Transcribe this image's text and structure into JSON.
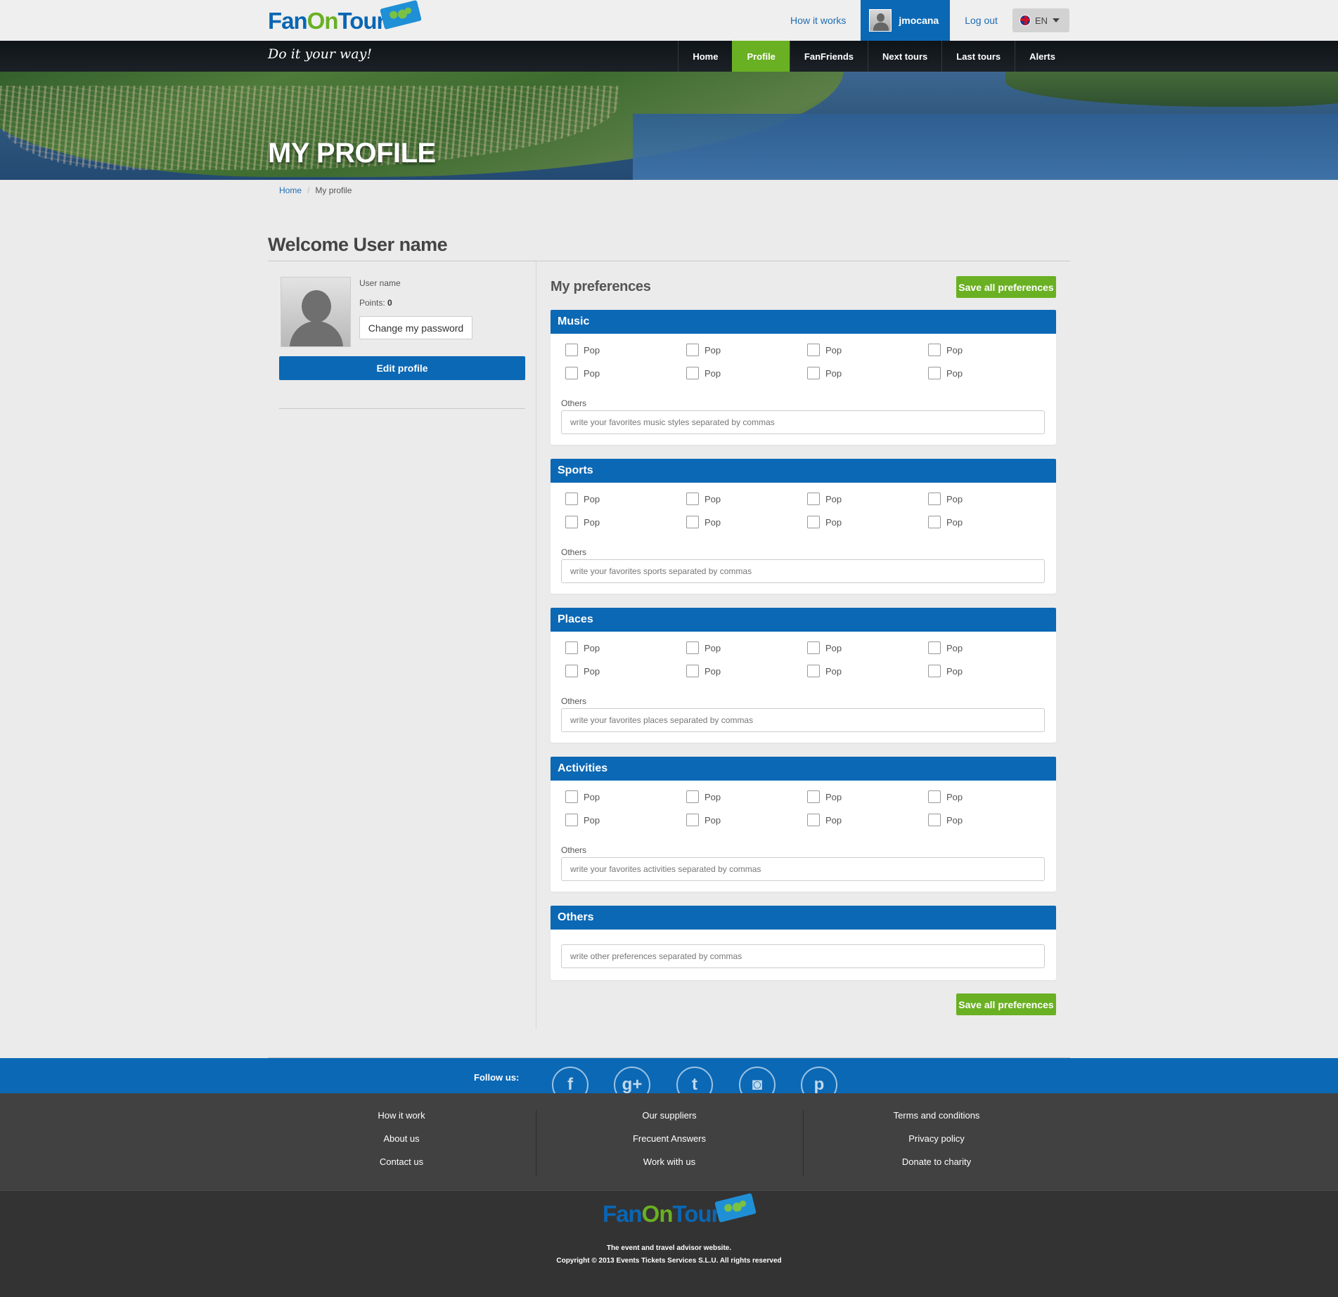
{
  "brand": {
    "logo_fan": "Fan",
    "logo_on": "On",
    "logo_tour": "Tour",
    "tagline": "Do it your way!",
    "colors": {
      "blue": "#0b68b5",
      "green": "#6ab023",
      "dark": "#333333"
    }
  },
  "topbar": {
    "how_it_works": "How it works",
    "username": "jmocana",
    "logout": "Log out",
    "language": "EN"
  },
  "nav": {
    "items": [
      "Home",
      "Profile",
      "FanFriends",
      "Next tours",
      "Last tours",
      "Alerts"
    ],
    "active": "Profile"
  },
  "hero": {
    "title": "MY PROFILE"
  },
  "breadcrumb": {
    "home": "Home",
    "current": "My profile"
  },
  "welcome": "Welcome User name",
  "profile": {
    "username": "User name",
    "points_label": "Points:",
    "points": "0",
    "change_password": "Change my password",
    "edit_profile": "Edit profile"
  },
  "preferences": {
    "title": "My preferences",
    "save_label": "Save all preferences",
    "others_label": "Others",
    "sections": [
      {
        "title": "Music",
        "options": [
          "Pop",
          "Pop",
          "Pop",
          "Pop",
          "Pop",
          "Pop",
          "Pop",
          "Pop"
        ],
        "placeholder": "write your favorites music styles separated by commas"
      },
      {
        "title": "Sports",
        "options": [
          "Pop",
          "Pop",
          "Pop",
          "Pop",
          "Pop",
          "Pop",
          "Pop",
          "Pop"
        ],
        "placeholder": "write your favorites sports separated by commas"
      },
      {
        "title": "Places",
        "options": [
          "Pop",
          "Pop",
          "Pop",
          "Pop",
          "Pop",
          "Pop",
          "Pop",
          "Pop"
        ],
        "placeholder": "write your favorites places separated by commas"
      },
      {
        "title": "Activities",
        "options": [
          "Pop",
          "Pop",
          "Pop",
          "Pop",
          "Pop",
          "Pop",
          "Pop",
          "Pop"
        ],
        "placeholder": "write your favorites activities separated by commas"
      },
      {
        "title": "Others",
        "options": [],
        "placeholder": "write other preferences separated by commas"
      }
    ]
  },
  "footer": {
    "follow_label": "Follow us:",
    "social": [
      {
        "name": "facebook",
        "glyph": "f"
      },
      {
        "name": "google-plus",
        "glyph": "g+"
      },
      {
        "name": "twitter",
        "glyph": "t"
      },
      {
        "name": "instagram",
        "glyph": "◙"
      },
      {
        "name": "pinterest",
        "glyph": "p"
      }
    ],
    "columns": [
      [
        "How it work",
        "About us",
        "Contact us"
      ],
      [
        "Our suppliers",
        "Frecuent Answers",
        "Work with us"
      ],
      [
        "Terms and conditions",
        "Privacy policy",
        "Donate to charity"
      ]
    ],
    "tagline": "The event and travel advisor website.",
    "copyright": "Copyright © 2013 Events Tickets Services S.L.U. All rights reserved"
  }
}
